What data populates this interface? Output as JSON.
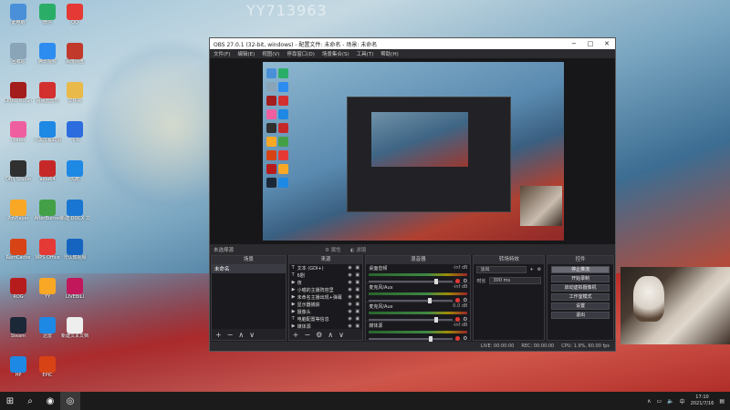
{
  "desktop": {
    "watermark": "YY713963",
    "icons": [
      {
        "label": "此电脑",
        "color": "#4a90d9"
      },
      {
        "label": "微信",
        "color": "#2aae67"
      },
      {
        "label": "QQ",
        "color": "#e53935"
      },
      {
        "label": "回收站",
        "color": "#8aa4b8"
      },
      {
        "label": "腾讯视频",
        "color": "#2d8cf0"
      },
      {
        "label": "百度网盘",
        "color": "#c0392b"
      },
      {
        "label": "CPUID ROG CPU-Z",
        "color": "#a31d1d"
      },
      {
        "label": "网易云音乐",
        "color": "#d32f2f"
      },
      {
        "label": "文件夹",
        "color": "#e9b949"
      },
      {
        "label": "iTunes",
        "color": "#ef5fa0"
      },
      {
        "label": "小黑屏幕截图",
        "color": "#1e88e5"
      },
      {
        "label": "飞书",
        "color": "#2d6cdf"
      },
      {
        "label": "OBS Studio",
        "color": "#303030"
      },
      {
        "label": "aida64",
        "color": "#c62828"
      },
      {
        "label": "优酷",
        "color": "#1e88e5"
      },
      {
        "label": "PotPlayer",
        "color": "#f9a825"
      },
      {
        "label": "AfterBurner",
        "color": "#43a047"
      },
      {
        "label": "新建 DOCX 文档",
        "color": "#1976d2"
      },
      {
        "label": "RamCache",
        "color": "#d84315"
      },
      {
        "label": "WPS Office",
        "color": "#e53935"
      },
      {
        "label": "元认知视频",
        "color": "#1565c0"
      },
      {
        "label": "ROG",
        "color": "#b71c1c"
      },
      {
        "label": "YY",
        "color": "#f9a825"
      },
      {
        "label": "LIVEBILI",
        "color": "#c2185b"
      },
      {
        "label": "Steam",
        "color": "#1b2838"
      },
      {
        "label": "迅雷",
        "color": "#1e88e5"
      },
      {
        "label": "新建文本文档",
        "color": "#eeeeee"
      },
      {
        "label": "HP",
        "color": "#1e88e5"
      },
      {
        "label": "EPIC",
        "color": "#d84315"
      }
    ]
  },
  "obs": {
    "title": "OBS 27.0.1 (32-bit, windows) - 配置文件: 未命名 - 场景: 未命名",
    "menu": [
      "文件(F)",
      "编辑(E)",
      "视图(V)",
      "停靠窗口(D)",
      "场景集合(S)",
      "工具(T)",
      "帮助(H)"
    ],
    "scene_bar": {
      "label": "未选择源",
      "props": "属性",
      "filters": "滤镜"
    },
    "docks": {
      "scenes": {
        "title": "场景",
        "items": [
          "未命名"
        ]
      },
      "sources": {
        "title": "来源",
        "items": [
          {
            "icon": "T",
            "name": "文本 (GDI+)"
          },
          {
            "icon": "T",
            "name": "6剧"
          },
          {
            "icon": "▶",
            "name": "夜"
          },
          {
            "icon": "▶",
            "name": "小喵的主播阵容里"
          },
          {
            "icon": "▶",
            "name": "未命名主播出现+弹幕"
          },
          {
            "icon": "▶",
            "name": "显示器捕获"
          },
          {
            "icon": "▶",
            "name": "摄像头"
          },
          {
            "icon": "T",
            "name": "电脑配置等信息"
          },
          {
            "icon": "▶",
            "name": "媒体源"
          }
        ]
      },
      "mixer": {
        "title": "混音器",
        "channels": [
          {
            "name": "桌面音频",
            "db": "-inf dB",
            "level": 0.78
          },
          {
            "name": "麦克风/Aux",
            "db": "-inf dB",
            "level": 0.7
          },
          {
            "name": "麦克风/Aux",
            "db": "0.0 dB",
            "level": 0.78
          },
          {
            "name": "媒体源",
            "db": "-inf dB",
            "level": 0.72
          }
        ]
      },
      "transitions": {
        "title": "转场特效",
        "type": "淡出",
        "duration_label": "时长",
        "duration": "300 ms"
      },
      "controls": {
        "title": "控件",
        "buttons": [
          "停止推流",
          "开始录制",
          "启动虚拟摄像机",
          "工作室模式",
          "设置",
          "退出"
        ]
      }
    },
    "status": {
      "live": "LIVE: 00:00:00",
      "rec": "REC: 00:00:00",
      "cpu": "CPU: 1.9%, 60.00 fps"
    }
  },
  "taskbar": {
    "time": "17:10",
    "date": "2021/7/16"
  }
}
